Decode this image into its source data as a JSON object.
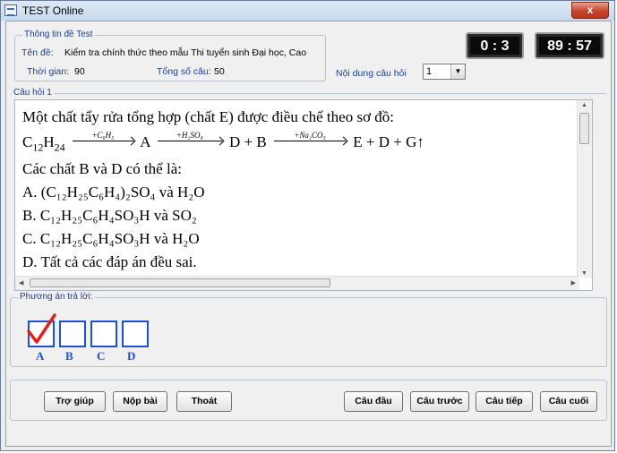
{
  "window": {
    "title": "TEST Online",
    "close_glyph": "x"
  },
  "test_info": {
    "legend": "Thông tin đề Test",
    "exam_label": "Tên đề:",
    "exam_name": "Kiểm tra chính thức theo mẫu Thi tuyển sinh Đại học, Cao",
    "time_label": "Thời gian:",
    "time_value": "90",
    "total_label": "Tổng số câu:",
    "total_value": "50"
  },
  "counters": {
    "question_progress": "0 : 3",
    "time_remaining": "89 : 57"
  },
  "question_selector": {
    "label": "Nội dung câu hỏi",
    "value": "1"
  },
  "question": {
    "legend": "Câu hỏi 1",
    "line1": "Một chất tẩy rửa tổng hợp (chất E) được điều chế theo sơ đồ:",
    "scheme": {
      "start_main": "C",
      "start_sub1": "12",
      "start_mid": "H",
      "start_sub2": "24",
      "cond1": "+C₆H₅",
      "product1": "A",
      "cond2": "+H₂SO₄",
      "product2": "D + B",
      "cond3": "+Na₂CO₃",
      "product3": "E + D + G",
      "gas_arrow": "↑"
    },
    "line3": "Các chất B và D có thể là:",
    "option_a": "A. (C₁₂H₂₅C₆H₄)₂SO₄ và H₂O",
    "option_b": "B. C₁₂H₂₅C₆H₄SO₃H và SO₂",
    "option_c": "C. C₁₂H₂₅C₆H₄SO₃H và H₂O",
    "option_d": "D. Tất cả các đáp án đều sai."
  },
  "answers": {
    "legend": "Phương án trả lời:",
    "options": [
      {
        "label": "A",
        "checked": true
      },
      {
        "label": "B",
        "checked": false
      },
      {
        "label": "C",
        "checked": false
      },
      {
        "label": "D",
        "checked": false
      }
    ]
  },
  "buttons": {
    "help": "Trợ giúp",
    "submit": "Nộp bài",
    "exit": "Thoát",
    "first": "Câu đầu",
    "prev": "Câu trước",
    "next": "Câu tiếp",
    "last": "Câu cuối"
  },
  "colors": {
    "accent_blue": "#1a4fd6",
    "check_red": "#e0201c",
    "label_blue": "#1d3f8a"
  }
}
